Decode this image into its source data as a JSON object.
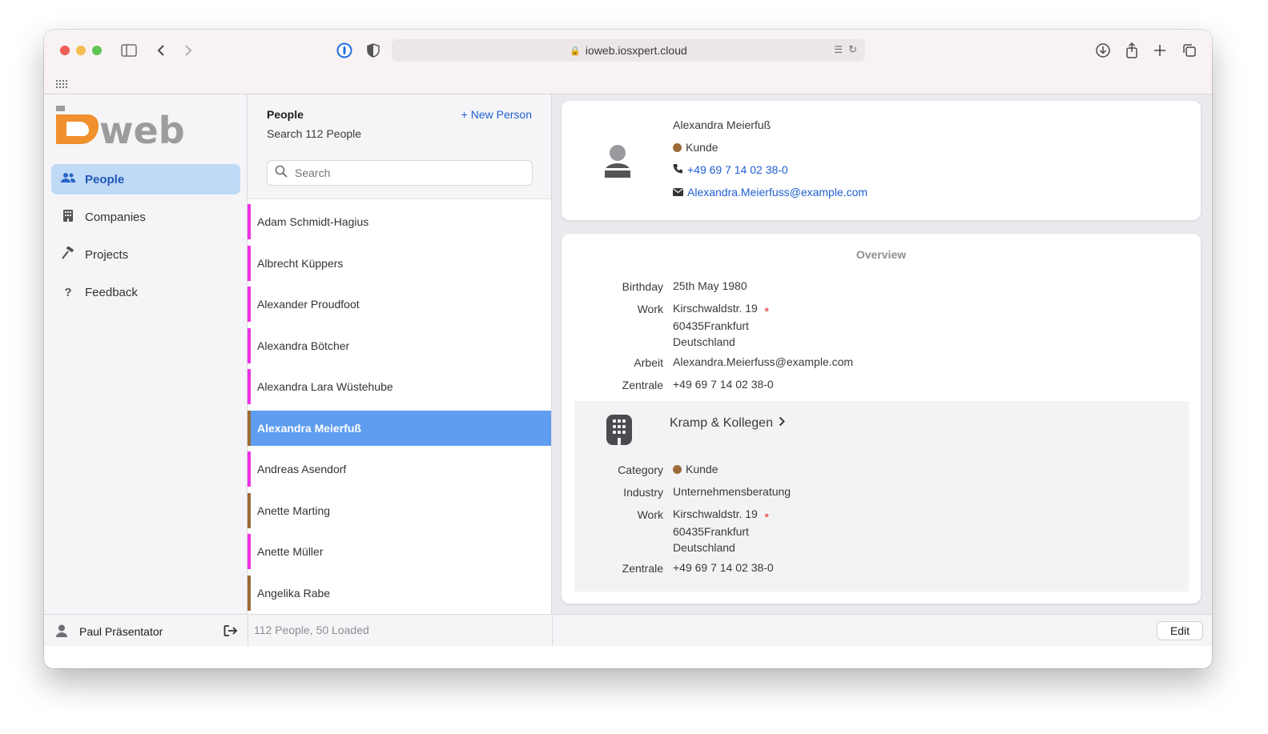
{
  "browser": {
    "url": "ioweb.iosxpert.cloud",
    "traffic_lights": {
      "close": "#ed5f57",
      "minimize": "#f5bd4f",
      "zoom": "#5fc454"
    }
  },
  "app": {
    "logo_prefix": "i",
    "logo_text": "web",
    "brand_orange": "#f0912d",
    "brand_gray": "#9c9c9c"
  },
  "sidebar": {
    "items": [
      {
        "label": "People",
        "icon": "people-icon",
        "active": true
      },
      {
        "label": "Companies",
        "icon": "building-icon",
        "active": false
      },
      {
        "label": "Projects",
        "icon": "hammer-icon",
        "active": false
      },
      {
        "label": "Feedback",
        "icon": "question-icon",
        "active": false
      }
    ],
    "user_name": "Paul Präsentator"
  },
  "list": {
    "title": "People",
    "subtitle": "Search 112 People",
    "new_label": "+ New Person",
    "search_placeholder": "Search",
    "status": "112 People, 50 Loaded",
    "rows": [
      {
        "name": "Adam Schmidt-Hagius",
        "color": "#ee32e6"
      },
      {
        "name": "Albrecht Küppers",
        "color": "#ee32e6"
      },
      {
        "name": "Alexander Proudfoot",
        "color": "#ee32e6"
      },
      {
        "name": "Alexandra Bötcher",
        "color": "#ee32e6"
      },
      {
        "name": "Alexandra Lara Wüstehube",
        "color": "#ee32e6"
      },
      {
        "name": "Alexandra Meierfuß",
        "color": "#9b6a37",
        "selected": true
      },
      {
        "name": "Andreas Asendorf",
        "color": "#ee32e6"
      },
      {
        "name": "Anette Marting",
        "color": "#9b6a37"
      },
      {
        "name": "Anette Müller",
        "color": "#ee32e6"
      },
      {
        "name": "Angelika Rabe",
        "color": "#9b6a37"
      }
    ]
  },
  "contact": {
    "name": "Alexandra Meierfuß",
    "category": "Kunde",
    "category_color": "#9b6a37",
    "phone": "+49 69 7 14 02 38-0",
    "email": "Alexandra.Meierfuss@example.com"
  },
  "overview": {
    "title": "Overview",
    "birthday_label": "Birthday",
    "birthday": "25th May 1980",
    "work_label": "Work",
    "work_street": "Kirschwaldstr. 19",
    "work_city": "60435Frankfurt",
    "work_country": "Deutschland",
    "arbeit_label": "Arbeit",
    "arbeit_email": "Alexandra.Meierfuss@example.com",
    "zentrale_label": "Zentrale",
    "zentrale_phone": "+49 69 7 14 02 38-0"
  },
  "company": {
    "name": "Kramp & Kollegen",
    "category_label": "Category",
    "category": "Kunde",
    "industry_label": "Industry",
    "industry": "Unternehmensberatung",
    "work_label": "Work",
    "street": "Kirschwaldstr. 19",
    "city": "60435Frankfurt",
    "country": "Deutschland",
    "zentrale_label": "Zentrale",
    "zentrale_phone": "+49 69 7 14 02 38-0"
  },
  "actions": {
    "edit_label": "Edit"
  }
}
